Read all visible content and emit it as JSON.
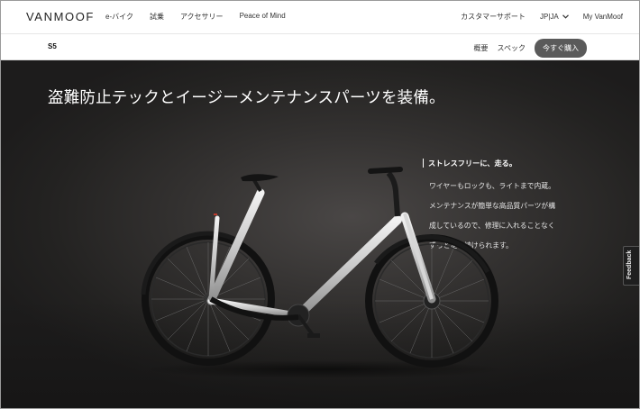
{
  "brand": {
    "logo": "VANMOOF"
  },
  "topnav": {
    "left_items": [
      "e-バイク",
      "試乗",
      "アクセサリー",
      "Peace of Mind"
    ],
    "support": "カスタマーサポート",
    "language": "JP|JA",
    "account": "My VanMoof"
  },
  "subnav": {
    "model": "S5",
    "links": [
      "概要",
      "スペック"
    ],
    "buy_button": "今すぐ購入"
  },
  "hero": {
    "title": "盗難防止テックとイージーメンテナンスパーツを装備。",
    "callout": {
      "heading": "ストレスフリーに、走る。",
      "body_lines": [
        "ワイヤーもロックも、ライトまで内蔵。",
        "メンテナンスが簡単な高品質パーツが構",
        "成しているので、修理に入れることなく",
        "ずっと走り続けられます。"
      ]
    }
  },
  "feedback_tab": "Feedback",
  "colors": {
    "hero_bg": "#2b2a29",
    "buy_button_bg": "#5a5a5a",
    "frame_silver": "#d8d8d8"
  },
  "icons": [
    "chevron-down-icon",
    "bike-image"
  ]
}
